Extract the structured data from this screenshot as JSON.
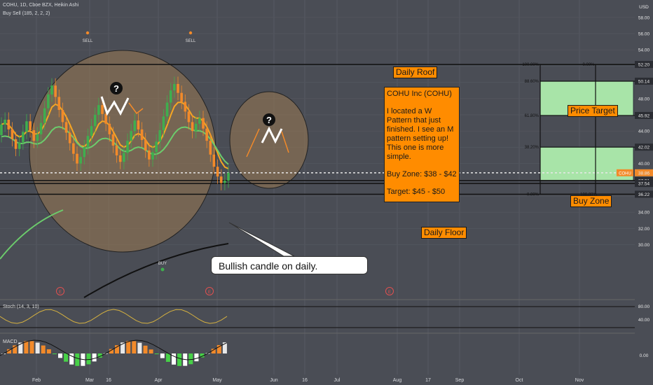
{
  "header": {
    "symbol_line": "COHU, 1D, Cboe BZX, Heikin Ashi",
    "indicator_line": "Buy Sell  (185, 2, 2, 2)"
  },
  "colors": {
    "background": "#4a4d55",
    "bull": "#3fae4e",
    "bear": "#f28a2a",
    "ema_fast": "#f5a623",
    "ema_slow": "#6ccc6c",
    "zone_fill": "#a8e4a8",
    "label_orange": "#ff8c00"
  },
  "chart_data": {
    "type": "candlestick",
    "symbol": "COHU",
    "timeframe": "1D",
    "style": "Heikin Ashi",
    "x_tick_labels": [
      "Feb",
      "Mar",
      "16",
      "Apr",
      "May",
      "Jun",
      "16",
      "Jul",
      "Aug",
      "17",
      "Sep",
      "Oct",
      "Nov"
    ],
    "y_tick_labels": [
      "58.00",
      "56.00",
      "54.00",
      "52.20",
      "50.14",
      "48.00",
      "45.92",
      "44.00",
      "42.02",
      "40.00",
      "38.86",
      "37.91",
      "37.54",
      "36.22",
      "34.00",
      "32.00",
      "30.00"
    ],
    "ylim": [
      29,
      59
    ],
    "axis_unit_label": "USD",
    "last_price_tag": "COHU",
    "last_price_value": "38.86",
    "candles_approx": [
      {
        "o": 43.5,
        "c": 44.8
      },
      {
        "o": 44.8,
        "c": 45.4
      },
      {
        "o": 45.4,
        "c": 44.2
      },
      {
        "o": 44.2,
        "c": 43.0
      },
      {
        "o": 43.0,
        "c": 41.8
      },
      {
        "o": 41.8,
        "c": 42.6
      },
      {
        "o": 42.6,
        "c": 43.9
      },
      {
        "o": 43.9,
        "c": 45.2
      },
      {
        "o": 45.2,
        "c": 44.1
      },
      {
        "o": 44.1,
        "c": 42.8
      },
      {
        "o": 42.8,
        "c": 43.6
      },
      {
        "o": 43.6,
        "c": 45.0
      },
      {
        "o": 45.0,
        "c": 46.8
      },
      {
        "o": 46.8,
        "c": 48.5
      },
      {
        "o": 48.5,
        "c": 49.6
      },
      {
        "o": 49.6,
        "c": 48.2
      },
      {
        "o": 48.2,
        "c": 46.6
      },
      {
        "o": 46.6,
        "c": 45.1
      },
      {
        "o": 45.1,
        "c": 43.8
      },
      {
        "o": 43.8,
        "c": 42.5
      },
      {
        "o": 42.5,
        "c": 41.2
      },
      {
        "o": 41.2,
        "c": 40.0
      },
      {
        "o": 40.0,
        "c": 40.8
      },
      {
        "o": 40.8,
        "c": 42.0
      },
      {
        "o": 42.0,
        "c": 43.4
      },
      {
        "o": 43.4,
        "c": 44.6
      },
      {
        "o": 44.6,
        "c": 46.0
      },
      {
        "o": 46.0,
        "c": 47.2
      },
      {
        "o": 47.2,
        "c": 46.1
      },
      {
        "o": 46.1,
        "c": 44.9
      },
      {
        "o": 44.9,
        "c": 43.6
      },
      {
        "o": 43.6,
        "c": 42.2
      },
      {
        "o": 42.2,
        "c": 41.0
      },
      {
        "o": 41.0,
        "c": 40.2
      },
      {
        "o": 40.2,
        "c": 41.3
      },
      {
        "o": 41.3,
        "c": 42.8
      },
      {
        "o": 42.8,
        "c": 44.0
      },
      {
        "o": 44.0,
        "c": 45.3
      },
      {
        "o": 45.3,
        "c": 44.2
      },
      {
        "o": 44.2,
        "c": 42.9
      },
      {
        "o": 42.9,
        "c": 41.6
      },
      {
        "o": 41.6,
        "c": 40.5
      },
      {
        "o": 40.5,
        "c": 41.4
      },
      {
        "o": 41.4,
        "c": 42.7
      },
      {
        "o": 42.7,
        "c": 44.1
      },
      {
        "o": 44.1,
        "c": 45.8
      },
      {
        "o": 45.8,
        "c": 47.5
      },
      {
        "o": 47.5,
        "c": 49.0
      },
      {
        "o": 49.0,
        "c": 49.8
      },
      {
        "o": 49.8,
        "c": 48.7
      },
      {
        "o": 48.7,
        "c": 47.6
      },
      {
        "o": 47.6,
        "c": 46.4
      },
      {
        "o": 46.4,
        "c": 45.1
      },
      {
        "o": 45.1,
        "c": 44.0
      },
      {
        "o": 44.0,
        "c": 44.9
      },
      {
        "o": 44.9,
        "c": 45.6
      },
      {
        "o": 45.6,
        "c": 44.3
      },
      {
        "o": 44.3,
        "c": 42.8
      },
      {
        "o": 42.8,
        "c": 41.1
      },
      {
        "o": 41.1,
        "c": 39.6
      },
      {
        "o": 39.6,
        "c": 38.4
      },
      {
        "o": 38.4,
        "c": 37.6
      },
      {
        "o": 37.6,
        "c": 37.9
      },
      {
        "o": 37.9,
        "c": 38.86
      }
    ],
    "horizontal_levels": [
      {
        "label": "Daily Roof",
        "value": 52.2
      },
      {
        "value": 37.91
      },
      {
        "value": 37.54
      },
      {
        "label": "Daily Floor",
        "value": 36.22
      }
    ],
    "fib_levels": [
      {
        "label": "100.00%",
        "value": 52.2
      },
      {
        "label": "88.60%",
        "value": 50.14
      },
      {
        "label": "61.80%",
        "value": 45.92
      },
      {
        "label": "38.20%",
        "value": 42.02
      },
      {
        "label": "0.00%",
        "value": 36.22
      }
    ],
    "fib_right_labels": [
      {
        "label": "0.00%",
        "value": 52.2
      },
      {
        "label": "38.20%",
        "value": 45.92
      },
      {
        "label": "100.00%",
        "value": 36.22
      }
    ],
    "zones": [
      {
        "label": "Price Target",
        "top": 50.14,
        "bottom": 45.92
      },
      {
        "label": "Buy Zone",
        "top": 42.02,
        "bottom": 37.91
      }
    ],
    "signals": [
      {
        "label": "SELL",
        "type": "sell"
      },
      {
        "label": "SELL",
        "type": "sell"
      },
      {
        "label": "BUY",
        "type": "buy"
      }
    ],
    "earnings_marker": "E",
    "stoch": {
      "label": "Stoch (14, 3, 10)",
      "y_tick_labels": [
        "80.00",
        "40.00"
      ]
    },
    "macd": {
      "label": "MACD",
      "y_tick_labels": [
        "0.00"
      ]
    }
  },
  "annotations": {
    "question_mark": "?",
    "note_title": "COHU Inc (COHU)",
    "note_body": "I located a W Pattern that just finished. I see an M pattern setting up! This one is more simple.",
    "note_buy": "Buy Zone: $38 - $42",
    "note_target": "Target: $45 - $50",
    "callout": "Bullish candle on daily.",
    "roof_label": "Daily Roof",
    "floor_label": "Daily Floor",
    "target_label": "Price Target",
    "buy_label": "Buy Zone"
  }
}
